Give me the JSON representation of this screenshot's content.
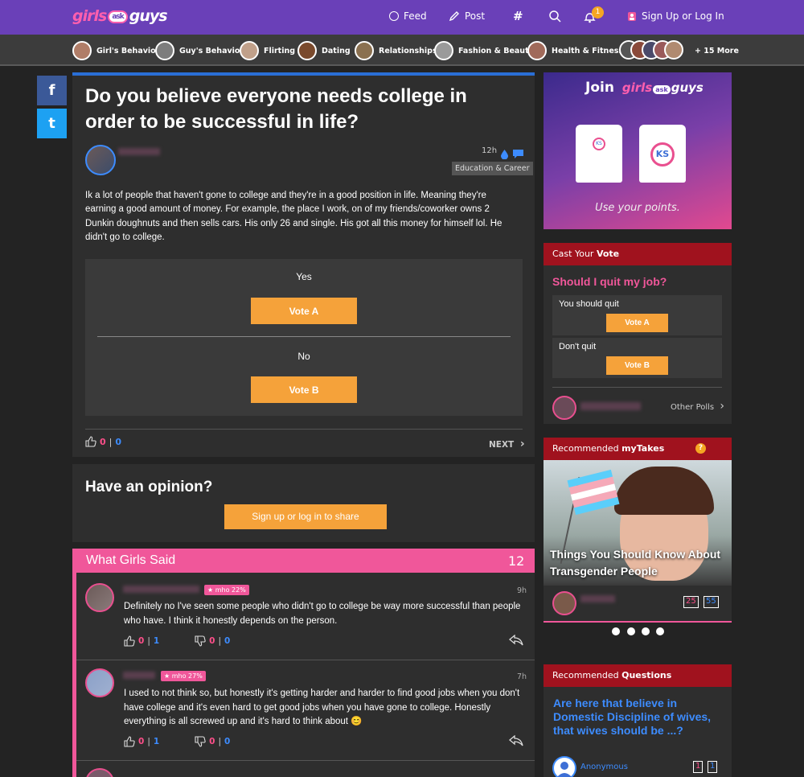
{
  "header": {
    "logo": {
      "girls": "girls",
      "ask": "ask",
      "guys": "guys"
    },
    "nav": {
      "feed": "Feed",
      "post": "Post",
      "hash": "#",
      "notif_count": "1",
      "signup": "Sign Up or Log In"
    }
  },
  "categories": [
    {
      "label": "Girl's Behavior",
      "color": "#b07d68"
    },
    {
      "label": "Guy's Behavior",
      "color": "#7d7d7d"
    },
    {
      "label": "Flirting",
      "color": "#c0a08a"
    },
    {
      "label": "Dating",
      "color": "#7a4a2d"
    },
    {
      "label": "Relationships",
      "color": "#8a7050"
    },
    {
      "label": "Fashion & Beauty",
      "color": "#9a9a9a"
    },
    {
      "label": "Health & Fitness",
      "color": "#a06a5a"
    }
  ],
  "more_categories": "+ 15 More",
  "social": {
    "facebook": "f",
    "twitter": "t"
  },
  "question": {
    "title": "Do you believe everyone needs college in order to be successful in life?",
    "time": "12h",
    "tag": "Education & Career",
    "body": "Ik a lot of people that haven't gone to college and they're in a good position in life. Meaning they're earning a good amount of money. For example, the place I work, on of my friends/coworker owns 2 Dunkin doughnuts and then sells cars. His only 26 and single. His got all this money for himself lol. He didn't go to college.",
    "poll": [
      {
        "label": "Yes",
        "button": "Vote A"
      },
      {
        "label": "No",
        "button": "Vote B"
      }
    ],
    "likes": "0",
    "dislikes": "0",
    "next": "NEXT"
  },
  "opinion": {
    "title": "Have an opinion?",
    "button": "Sign up or log in to share"
  },
  "girls_said": {
    "title": "What Girls Said",
    "count": "12",
    "comments": [
      {
        "mho": "mho 22%",
        "time": "9h",
        "text": "Definitely no I've seen some people who didn't go to college be way more successful than people who have. I think it honestly depends on the person.",
        "up": "0",
        "up_blue": "1",
        "down": "0",
        "down_blue": "0"
      },
      {
        "mho": "mho 27%",
        "time": "7h",
        "text": "I used to not think so, but honestly it's getting harder and harder to find good jobs when you don't have college and it's even hard to get good jobs when you have gone to college. Honestly everything is all screwed up and it's hard to think about 😊",
        "up": "0",
        "up_blue": "1",
        "down": "0",
        "down_blue": "0"
      }
    ]
  },
  "join": {
    "title": "Join",
    "subtitle": "Use your points.",
    "shirt_logo": "KS"
  },
  "vote_card": {
    "head_prefix": "Cast Your ",
    "head_bold": "Vote",
    "question": "Should I quit my job?",
    "options": [
      {
        "label": "You should quit",
        "button": "Vote A"
      },
      {
        "label": "Don't quit",
        "button": "Vote B"
      }
    ],
    "other": "Other Polls"
  },
  "mytakes": {
    "head_prefix": "Recommended ",
    "head_bold": "myTakes",
    "help": "?",
    "title": "Things You Should Know About Transgender People",
    "count_red": "25",
    "count_blue": "55"
  },
  "rec_questions": {
    "head_prefix": "Recommended ",
    "head_bold": "Questions",
    "question": "Are here that believe in Domestic Discipline of wives, that wives should be ...?",
    "author": "Anonymous",
    "count_red": "1",
    "count_blue": "1"
  },
  "colors": {
    "accent_purple": "#6a40b8",
    "pink": "#f0579a",
    "orange": "#f5a23a",
    "blue": "#3d8cff",
    "dark_red": "#a0121e"
  }
}
